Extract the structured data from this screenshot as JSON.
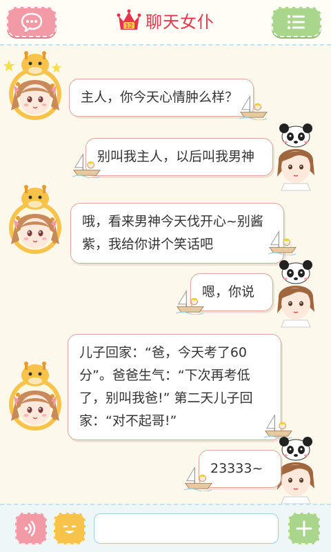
{
  "header": {
    "title": "聊天女仆",
    "crown_number": "12",
    "menu_icon": "menu-icon",
    "chat_icon": "chat-bubble-icon"
  },
  "messages": [
    {
      "sender": "maid",
      "text": "主人，你今天心情肿么样？"
    },
    {
      "sender": "user",
      "text": "别叫我主人，以后叫我男神"
    },
    {
      "sender": "maid",
      "text": "哦，看来男神今天伐开心~别酱紫，我给你讲个笑话吧"
    },
    {
      "sender": "user",
      "text": "嗯，你说"
    },
    {
      "sender": "maid",
      "text": "儿子回家：“爸，今天考了60分”。爸爸生气：“下次再考低了，别叫我爸!” 第二天儿子回家：“对不起哥!”"
    },
    {
      "sender": "user",
      "text": "23333~"
    }
  ],
  "footer": {
    "input_placeholder": "",
    "input_value": ""
  },
  "colors": {
    "accent_red": "#e8344a",
    "pink": "#f39aa7",
    "green": "#a9d68c",
    "yellow": "#f8c34a",
    "bubble_border": "#d8a99a"
  }
}
